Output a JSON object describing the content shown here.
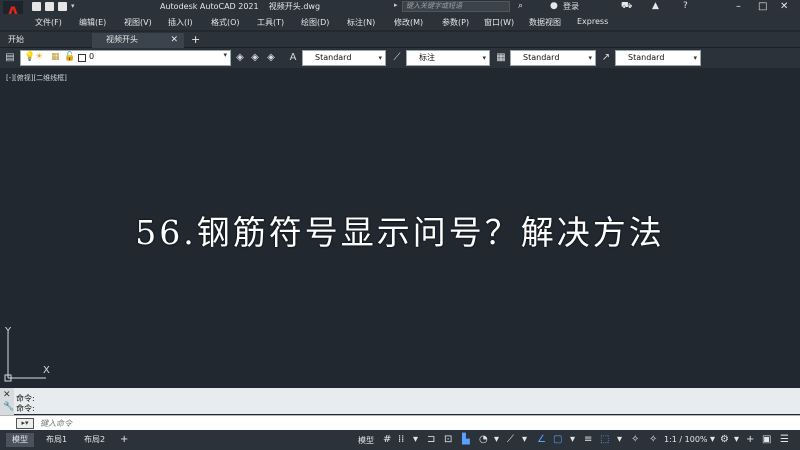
{
  "window": {
    "app_title": "Autodesk AutoCAD 2021    视频开头.dwg",
    "search_placeholder": "键入关键字或短语",
    "login_label": "登录"
  },
  "menu": [
    "文件(F)",
    "编辑(E)",
    "视图(V)",
    "插入(I)",
    "格式(O)",
    "工具(T)",
    "绘图(D)",
    "标注(N)",
    "修改(M)",
    "参数(P)",
    "窗口(W)",
    "数据视图",
    "Express"
  ],
  "tabs": {
    "start_label": "开始",
    "active_label": "视频开头"
  },
  "toolbar": {
    "layer_name": "0",
    "text_style": "Standard",
    "dim_style": "标注",
    "table_style": "Standard",
    "mleader_style": "Standard"
  },
  "canvas": {
    "viewport_label": "[-][俯视][二维线框]",
    "center_title": "56.钢筋符号显示问号？解决方法",
    "ucs_y": "Y",
    "ucs_x": "X"
  },
  "command": {
    "history": [
      "命令:",
      "命令:"
    ],
    "input_placeholder": "键入命令"
  },
  "status": {
    "layouts": [
      "模型",
      "布局1",
      "布局2"
    ],
    "model_label": "模型",
    "scale": "1:1 / 100%"
  },
  "colors": {
    "canvas_bg": "#212830",
    "chrome_bg": "#2b323a",
    "brand_red": "#e2231a"
  }
}
